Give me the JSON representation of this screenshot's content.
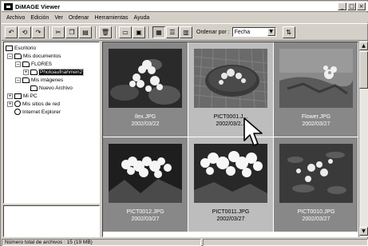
{
  "window": {
    "title": "DiMAGE Viewer"
  },
  "window_buttons": {
    "minimize": "_",
    "maximize": "□",
    "close": "×"
  },
  "menu": [
    "Archivo",
    "Edición",
    "Ver",
    "Ordenar",
    "Herramientas",
    "Ayuda"
  ],
  "toolbar": {
    "sort_label": "Ordenar por :",
    "sort_value": "Fecha"
  },
  "tree": [
    {
      "label": "Escritorio",
      "icon": "desktop-icon",
      "depth": 0,
      "expander": ""
    },
    {
      "label": "Mis documentos",
      "icon": "folder-icon",
      "depth": 1,
      "expander": "−"
    },
    {
      "label": "FLORES",
      "icon": "folder-icon",
      "depth": 2,
      "expander": "−"
    },
    {
      "label": "Photoaufnahmen2",
      "icon": "folder-icon",
      "depth": 3,
      "expander": "+",
      "selected": true
    },
    {
      "label": "Mis imágenes",
      "icon": "folder-icon",
      "depth": 2,
      "expander": "−"
    },
    {
      "label": "Nuevo Archivo",
      "icon": "folder-icon",
      "depth": 3,
      "expander": ""
    },
    {
      "label": "Mi PC",
      "icon": "computer-icon",
      "depth": 1,
      "expander": "+"
    },
    {
      "label": "Mis sitios de red",
      "icon": "network-icon",
      "depth": 1,
      "expander": "+"
    },
    {
      "label": "Internet Explorer",
      "icon": "ie-icon",
      "depth": 1,
      "expander": ""
    }
  ],
  "thumbnails": [
    {
      "name": "Ilex.JPG",
      "date": "2002/03/22",
      "selected": false
    },
    {
      "name": "PICT0001.J...",
      "date": "2002/03/2...",
      "selected": true
    },
    {
      "name": "Flower.JPG",
      "date": "2002/03/27",
      "selected": false
    },
    {
      "name": "PICT0012.JPG",
      "date": "2002/03/27",
      "selected": false
    },
    {
      "name": "PICT0011.JPG",
      "date": "2002/03/27",
      "selected": true
    },
    {
      "name": "PICT0010.JPG",
      "date": "2002/03/27",
      "selected": false
    }
  ],
  "status": {
    "text": "Número total de archivos : 15 (19 MB)"
  }
}
